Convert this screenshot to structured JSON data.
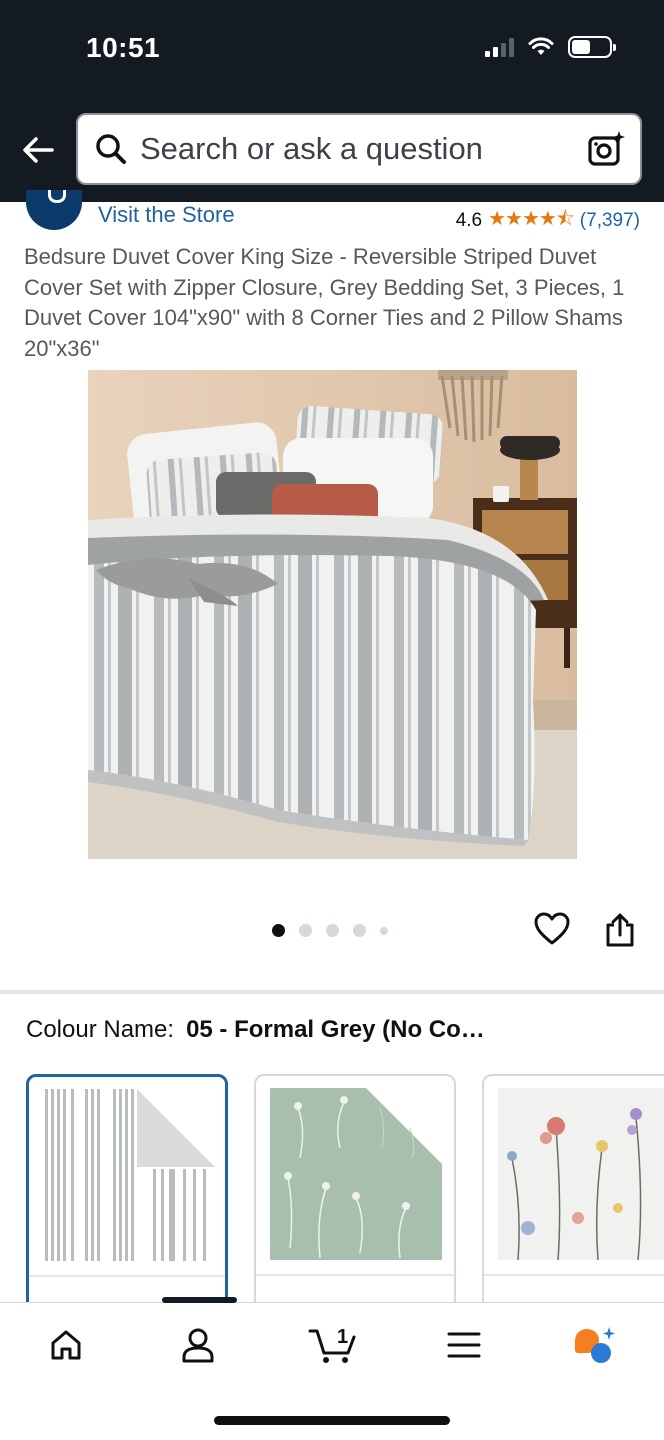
{
  "status_bar": {
    "time": "10:51"
  },
  "search": {
    "placeholder": "Search or ask a question"
  },
  "store": {
    "visit_label": "Visit the Store",
    "rating_value": "4.6",
    "stars": "★★★★⯪",
    "rating_count": "(7,397)"
  },
  "product": {
    "title": "Bedsure Duvet Cover King Size - Reversible Striped Duvet Cover Set with Zipper Closure, Grey Bedding Set, 3 Pieces, 1 Duvet Cover 104\"x90\" with 8 Corner Ties and 2 Pillow Shams 20\"x36\"",
    "image_count": 5,
    "active_image": 1
  },
  "variations": {
    "colour_label": "Colour Name:",
    "colour_value": "05 - Formal Grey (No Co…",
    "swatches": [
      {
        "name": "formal-grey",
        "selected": true
      },
      {
        "name": "sage-floral",
        "selected": false
      },
      {
        "name": "white-floral",
        "selected": false
      }
    ]
  },
  "colors": {
    "header_bg": "#131a22",
    "link": "#2162a1",
    "star": "#e47911",
    "selected_border": "#2162a1"
  },
  "bottom_nav": {
    "items": [
      "home-icon",
      "account-icon",
      "cart-icon",
      "menu-icon",
      "rufus-icon"
    ],
    "cart_count": "1"
  }
}
